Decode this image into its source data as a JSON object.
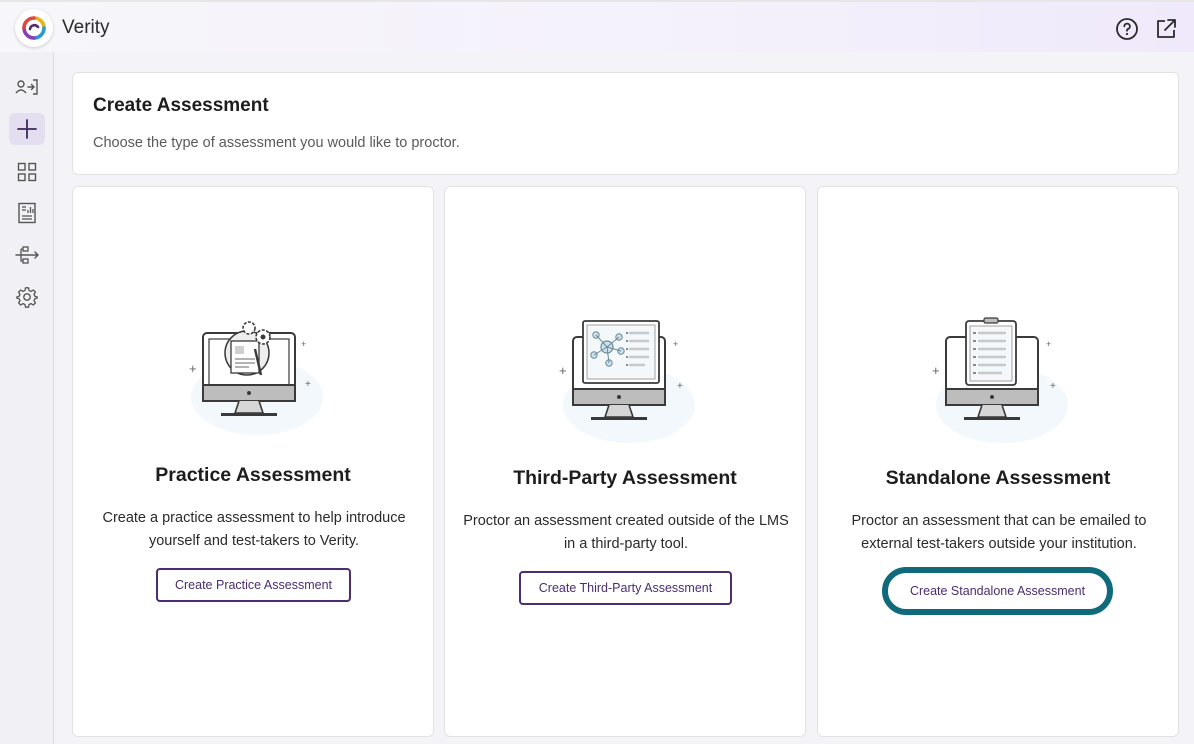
{
  "app": {
    "title": "Verity",
    "logo_icon": "verity-logo-icon",
    "accent_color": "#4a2d73",
    "focus_color": "#0f6b7b"
  },
  "topbar": {
    "help_icon": "help-circle-icon",
    "open_external_icon": "open-external-icon"
  },
  "sidebar": {
    "items": [
      {
        "name": "user-login-icon",
        "active": false
      },
      {
        "name": "plus-icon",
        "active": true
      },
      {
        "name": "grid-icon",
        "active": false
      },
      {
        "name": "report-icon",
        "active": false
      },
      {
        "name": "integration-icon",
        "active": false
      },
      {
        "name": "gear-icon",
        "active": false
      }
    ]
  },
  "header": {
    "title": "Create Assessment",
    "subtitle": "Choose the type of assessment you would like to proctor."
  },
  "cards": [
    {
      "title": "Practice Assessment",
      "description": "Create a practice assessment to help introduce yourself and test-takers to Verity.",
      "button_label": "Create Practice Assessment",
      "illustration": "monitor-gears-illustration"
    },
    {
      "title": "Third-Party Assessment",
      "description": "Proctor an assessment created outside of the LMS in a third-party tool.",
      "button_label": "Create Third-Party Assessment",
      "illustration": "monitor-network-illustration"
    },
    {
      "title": "Standalone Assessment",
      "description": "Proctor an assessment that can be emailed to external test-takers outside your institution.",
      "button_label": "Create Standalone Assessment",
      "illustration": "monitor-clipboard-illustration",
      "focused": true
    }
  ]
}
